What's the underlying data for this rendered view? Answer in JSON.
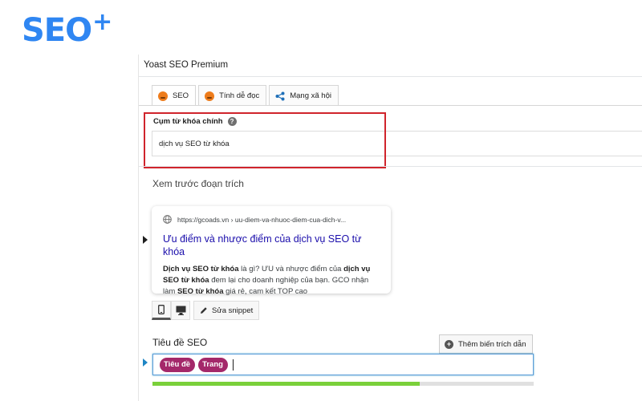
{
  "logo": {
    "text": "SEO",
    "plus": "+"
  },
  "panel": {
    "title": "Yoast SEO Premium",
    "tabs": [
      {
        "label": "SEO",
        "icon": "sad-face-icon"
      },
      {
        "label": "Tính dễ đọc",
        "icon": "sad-face-icon"
      },
      {
        "label": "Mạng xã hội",
        "icon": "share-icon"
      }
    ]
  },
  "keyphrase": {
    "label": "Cụm từ khóa chính",
    "help": "?",
    "value": "dịch vụ SEO từ khóa"
  },
  "snippet": {
    "section_title": "Xem trước đoạn trích",
    "url": "https://gcoads.vn › uu-diem-va-nhuoc-diem-cua-dich-v...",
    "headline": "Ưu điểm và nhược điểm của dịch vụ SEO từ khóa",
    "desc_parts": [
      {
        "text": "Dịch vụ SEO từ khóa",
        "bold": true
      },
      {
        "text": " là gì? ƯU và nhược điểm của ",
        "bold": false
      },
      {
        "text": "dịch vụ SEO từ khóa",
        "bold": true
      },
      {
        "text": " đem lại cho doanh nghiệp của bạn. GCO nhận làm ",
        "bold": false
      },
      {
        "text": "SEO từ khóa",
        "bold": true
      },
      {
        "text": " giá rẻ, cam kết TOP cao",
        "bold": false
      }
    ],
    "edit_label": "Sửa snippet"
  },
  "seo_title": {
    "label": "Tiêu đề SEO",
    "insert_label": "Thêm biến trích dẫn",
    "variables": [
      "Tiêu đề",
      "Trang"
    ],
    "progress": 0.7
  },
  "colors": {
    "brand": "#2f86f2",
    "highlight": "#d0242c",
    "pill": "#a4286a",
    "progress": "#7ad03a",
    "link": "#1a0dab"
  }
}
